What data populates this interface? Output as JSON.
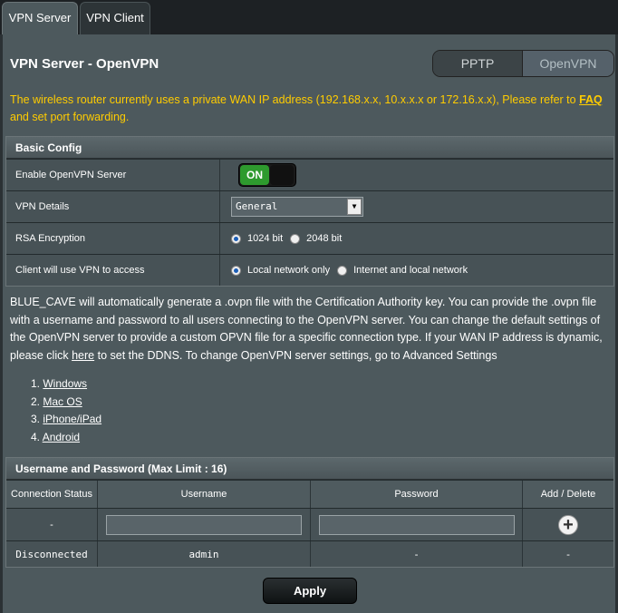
{
  "tabs": {
    "server": "VPN Server",
    "client": "VPN Client"
  },
  "page": {
    "title": "VPN Server - OpenVPN"
  },
  "mode_toggle": {
    "pptp": "PPTP",
    "openvpn": "OpenVPN"
  },
  "warning": {
    "text": "The wireless router currently uses a private WAN IP address (192.168.x.x, 10.x.x.x or 172.16.x.x), Please refer to ",
    "link": "FAQ",
    "suffix": " and set port forwarding."
  },
  "basic_config": {
    "header": "Basic Config",
    "enable_label": "Enable OpenVPN Server",
    "enable_state": "ON",
    "details_label": "VPN Details",
    "details_value": "General",
    "rsa_label": "RSA Encryption",
    "rsa_1024": "1024 bit",
    "rsa_2048": "2048 bit",
    "access_label": "Client will use VPN to access",
    "access_local": "Local network only",
    "access_both": "Internet and local network"
  },
  "description": {
    "text": "BLUE_CAVE will automatically generate a .ovpn file with the Certification Authority key. You can provide the .ovpn file with a username and password to all users connecting to the OpenVPN server. You can change the default settings of the OpenVPN server to provide a custom OPVN file for a specific connection type. If your WAN IP address is dynamic, please click ",
    "link": "here",
    "suffix": " to set the DDNS. To change OpenVPN server settings, go to Advanced Settings"
  },
  "os_links": [
    {
      "num": "1.",
      "label": "Windows"
    },
    {
      "num": "2.",
      "label": "Mac OS"
    },
    {
      "num": "3.",
      "label": "iPhone/iPad"
    },
    {
      "num": "4.",
      "label": "Android"
    }
  ],
  "users": {
    "header": "Username and Password (Max Limit : 16)",
    "col_status": "Connection Status",
    "col_username": "Username",
    "col_password": "Password",
    "col_action": "Add / Delete",
    "input_row_status": "-",
    "rows": [
      {
        "status": "Disconnected",
        "username": "admin",
        "password": "-",
        "action": "-"
      }
    ]
  },
  "apply_label": "Apply",
  "colors": {
    "accent_warning": "#ffcc00",
    "toggle_on": "#2e9a2e",
    "panel": "#4d595d"
  }
}
